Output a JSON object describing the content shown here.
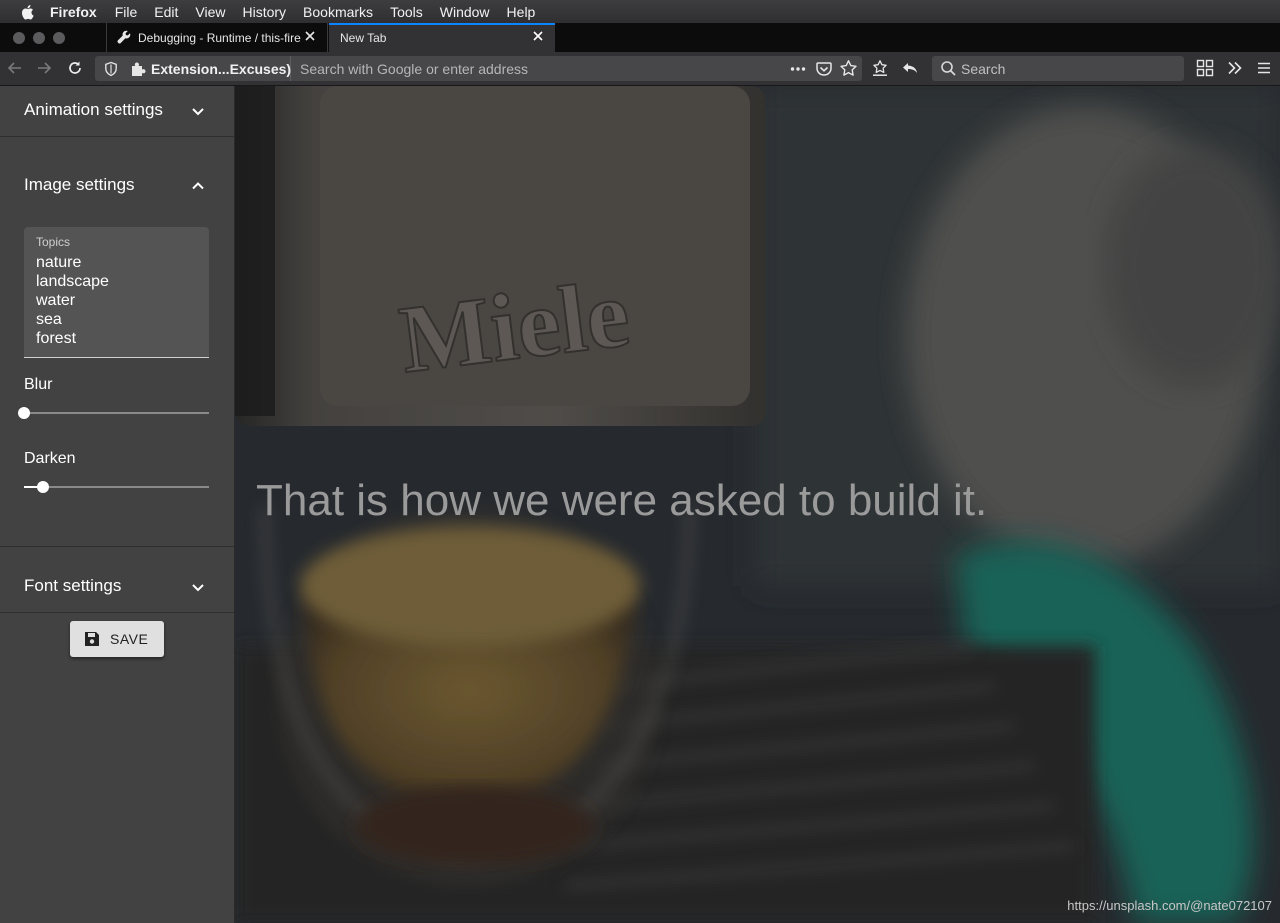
{
  "menubar": {
    "app_name": "Firefox",
    "items": [
      "File",
      "Edit",
      "View",
      "History",
      "Bookmarks",
      "Tools",
      "Window",
      "Help"
    ]
  },
  "tabs": [
    {
      "title": "Debugging - Runtime / this-fire",
      "icon": "wrench-icon",
      "active": false
    },
    {
      "title": "New Tab",
      "icon": "",
      "active": true
    }
  ],
  "urlbar": {
    "extension_label": "Extension...Excuses)",
    "placeholder": "Search with Google or enter address"
  },
  "searchbar": {
    "placeholder": "Search"
  },
  "sidebar": {
    "sections": {
      "animation": {
        "label": "Animation settings",
        "expanded": false
      },
      "image": {
        "label": "Image settings",
        "expanded": true
      },
      "font": {
        "label": "Font settings",
        "expanded": false
      }
    },
    "topics": {
      "label": "Topics",
      "value": "nature\nlandscape\nwater\nsea\nforest"
    },
    "blur": {
      "label": "Blur",
      "value_fraction": 0.0
    },
    "darken": {
      "label": "Darken",
      "value_fraction": 0.1
    },
    "save_label": "SAVE"
  },
  "content": {
    "quote": "That is how we were asked to build it.",
    "credit": "https://unsplash.com/@nate072107"
  },
  "colors": {
    "tab_accent": "#0a84ff",
    "sidebar_bg": "#424242",
    "toolbar_bg": "#323234"
  }
}
